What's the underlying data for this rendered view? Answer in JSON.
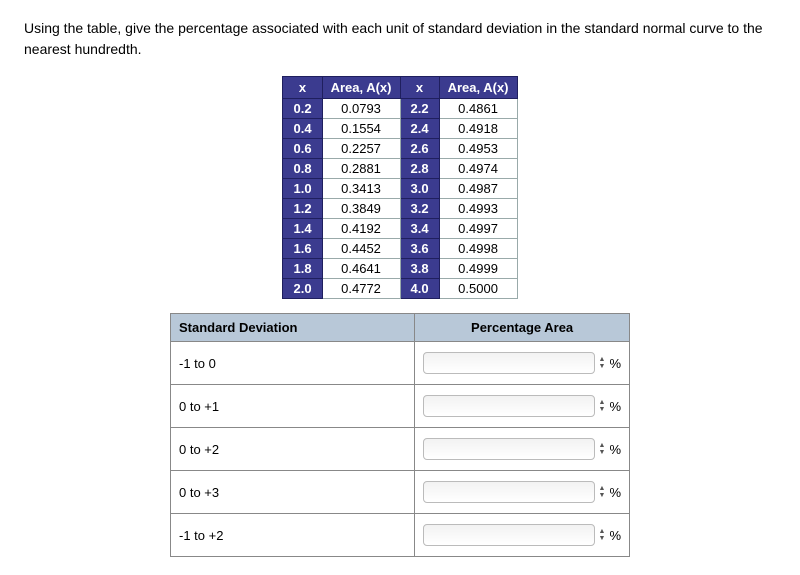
{
  "question": "Using the table, give the percentage associated with each unit of standard deviation in the standard normal curve to the nearest hundredth.",
  "area_table": {
    "headers": [
      "x",
      "Area, A(x)",
      "x",
      "Area, A(x)"
    ],
    "rows": [
      {
        "x1": "0.2",
        "a1": "0.0793",
        "x2": "2.2",
        "a2": "0.4861"
      },
      {
        "x1": "0.4",
        "a1": "0.1554",
        "x2": "2.4",
        "a2": "0.4918"
      },
      {
        "x1": "0.6",
        "a1": "0.2257",
        "x2": "2.6",
        "a2": "0.4953"
      },
      {
        "x1": "0.8",
        "a1": "0.2881",
        "x2": "2.8",
        "a2": "0.4974"
      },
      {
        "x1": "1.0",
        "a1": "0.3413",
        "x2": "3.0",
        "a2": "0.4987"
      },
      {
        "x1": "1.2",
        "a1": "0.3849",
        "x2": "3.2",
        "a2": "0.4993"
      },
      {
        "x1": "1.4",
        "a1": "0.4192",
        "x2": "3.4",
        "a2": "0.4997"
      },
      {
        "x1": "1.6",
        "a1": "0.4452",
        "x2": "3.6",
        "a2": "0.4998"
      },
      {
        "x1": "1.8",
        "a1": "0.4641",
        "x2": "3.8",
        "a2": "0.4999"
      },
      {
        "x1": "2.0",
        "a1": "0.4772",
        "x2": "4.0",
        "a2": "0.5000"
      }
    ]
  },
  "answer_table": {
    "headers": {
      "sd": "Standard Deviation",
      "pa": "Percentage Area"
    },
    "rows": [
      {
        "label": "-1 to 0",
        "value": "",
        "unit": "%"
      },
      {
        "label": "0 to +1",
        "value": "",
        "unit": "%"
      },
      {
        "label": "0 to +2",
        "value": "",
        "unit": "%"
      },
      {
        "label": "0 to +3",
        "value": "",
        "unit": "%"
      },
      {
        "label": "-1 to +2",
        "value": "",
        "unit": "%"
      }
    ]
  },
  "chart_data": {
    "type": "table",
    "title": "Standard normal area table A(x)",
    "x": [
      0.2,
      0.4,
      0.6,
      0.8,
      1.0,
      1.2,
      1.4,
      1.6,
      1.8,
      2.0,
      2.2,
      2.4,
      2.6,
      2.8,
      3.0,
      3.2,
      3.4,
      3.6,
      3.8,
      4.0
    ],
    "values": [
      0.0793,
      0.1554,
      0.2257,
      0.2881,
      0.3413,
      0.3849,
      0.4192,
      0.4452,
      0.4641,
      0.4772,
      0.4861,
      0.4918,
      0.4953,
      0.4974,
      0.4987,
      0.4993,
      0.4997,
      0.4998,
      0.4999,
      0.5
    ]
  }
}
